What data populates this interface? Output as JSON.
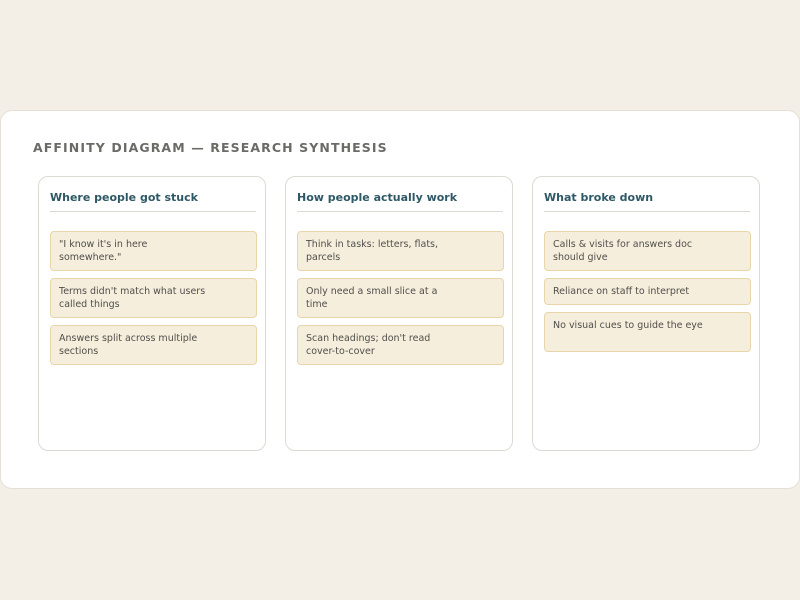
{
  "diagram": {
    "title": "AFFINITY DIAGRAM — RESEARCH SYNTHESIS",
    "columns": [
      {
        "heading": "Where people got stuck",
        "notes": [
          "\"I know it's in here somewhere.\"",
          "Terms didn't match what users called things",
          "Answers split across multiple sections"
        ]
      },
      {
        "heading": "How people actually work",
        "notes": [
          "Think in tasks: letters, flats, parcels",
          "Only need a small slice at a time",
          "Scan headings; don't read cover-to-cover"
        ]
      },
      {
        "heading": "What broke down",
        "notes": [
          "Calls & visits for answers doc should give",
          "Reliance on staff to interpret",
          "No visual cues to guide the eye"
        ]
      }
    ]
  }
}
